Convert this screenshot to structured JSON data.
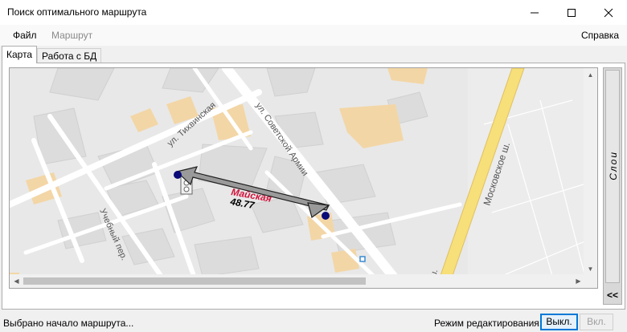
{
  "window": {
    "title": "Поиск оптимального маршрута"
  },
  "menu": {
    "file": "Файл",
    "route": "Маршрут",
    "help": "Справка"
  },
  "tabs": [
    {
      "label": "Карта"
    },
    {
      "label": "Работа с БД"
    }
  ],
  "map": {
    "streets": {
      "tikhvinskaya": "ул. Тихвинская",
      "sovetskoy_armii": "ул. Советской Армии",
      "moskovskoe": "Московское ш.",
      "uchebny": "Учебный пер.",
      "moskovskoe_fragment": "е ш."
    },
    "route": {
      "name": "Майская",
      "distance": "48.77"
    }
  },
  "layers_panel": {
    "label": "Слои",
    "toggle": "<<"
  },
  "status": {
    "message": "Выбрано начало маршрута...",
    "mode_label": "Режим редактирования:",
    "off_button": "Выкл.",
    "on_button": "Вкл."
  },
  "colors": {
    "route_point": "#0a0a78",
    "route_label": "#d2143c",
    "highway": "#f7df7a",
    "building": "#f3d6a6",
    "accent": "#0078d7"
  },
  "icons": {
    "minimize": "minimize-icon",
    "maximize": "maximize-icon",
    "close": "close-icon"
  }
}
